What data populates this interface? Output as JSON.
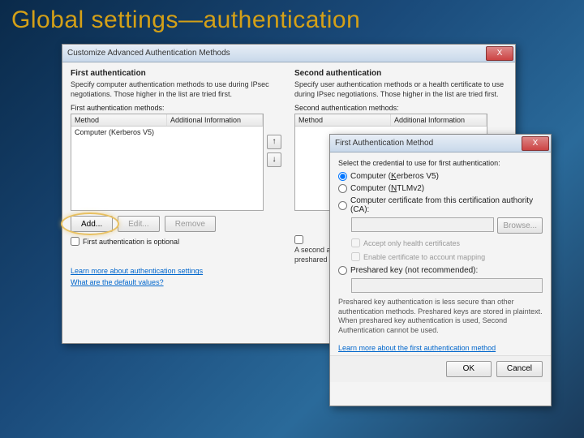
{
  "slide": {
    "title": "Global settings—authentication"
  },
  "mainWin": {
    "title": "Customize Advanced Authentication Methods",
    "close": "X",
    "first": {
      "heading": "First authentication",
      "desc": "Specify computer authentication methods to use during IPsec negotiations. Those higher in the list are tried first.",
      "label": "First authentication methods:",
      "col1": "Method",
      "col2": "Additional Information",
      "row1": "Computer (Kerberos V5)",
      "add": "Add...",
      "edit": "Edit...",
      "remove": "Remove",
      "up": "↑",
      "down": "↓",
      "optional": "First authentication is optional"
    },
    "second": {
      "heading": "Second authentication",
      "desc": "Specify user authentication methods or a health certificate to use during IPsec negotiations. Those higher in the list are tried first.",
      "label": "Second authentication methods:",
      "col1": "Method",
      "col2": "Additional Information"
    },
    "truncated": "A second authentication method cannot be specified when a preshared key is in the first authentication methods list.",
    "link1": "Learn more about authentication settings",
    "link2": "What are the default values?"
  },
  "subWin": {
    "title": "First Authentication Method",
    "close": "X",
    "prompt": "Select the credential to use for first authentication:",
    "r1a": "Computer (",
    "r1u": "K",
    "r1b": "erberos V5)",
    "r2a": "Computer (",
    "r2u": "N",
    "r2b": "TLMv2)",
    "r3": "Computer certificate from this certification authority (CA):",
    "browse": "Browse...",
    "c1": "Accept only health certificates",
    "c2": "Enable certificate to account mapping",
    "r4": "Preshared key (not recommended):",
    "note": "Preshared key authentication is less secure than other authentication methods. Preshared keys are stored in plaintext. When preshared key authentication is used, Second Authentication cannot be used.",
    "link": "Learn more about the first authentication method",
    "ok": "OK",
    "cancel": "Cancel"
  }
}
